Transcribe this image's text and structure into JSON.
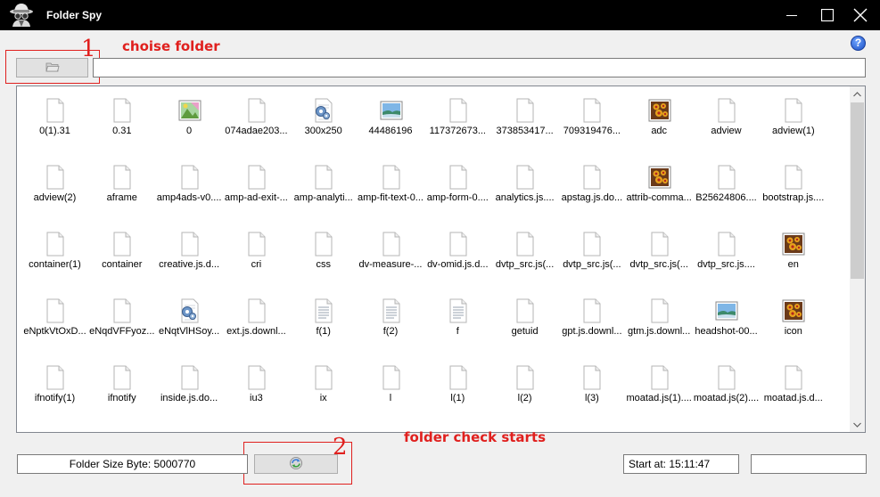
{
  "window": {
    "title": "Folder Spy"
  },
  "annotations": {
    "step1_text": "choise folder",
    "step1_num": "1",
    "step2_text": "folder check starts",
    "step2_num": "2"
  },
  "toolbar": {
    "path_value": "",
    "help_label": "?"
  },
  "files": [
    {
      "name": "0(1).31",
      "icon": "file"
    },
    {
      "name": "0.31",
      "icon": "file"
    },
    {
      "name": "0",
      "icon": "image-green"
    },
    {
      "name": "074adae203...",
      "icon": "file"
    },
    {
      "name": "300x250",
      "icon": "gear"
    },
    {
      "name": "44486196",
      "icon": "image-landscape"
    },
    {
      "name": "117372673...",
      "icon": "file"
    },
    {
      "name": "373853417...",
      "icon": "file"
    },
    {
      "name": "709319476...",
      "icon": "file"
    },
    {
      "name": "adc",
      "icon": "image-flower"
    },
    {
      "name": "adview",
      "icon": "file"
    },
    {
      "name": "adview(1)",
      "icon": "file"
    },
    {
      "name": "adview(2)",
      "icon": "file"
    },
    {
      "name": "aframe",
      "icon": "file"
    },
    {
      "name": "amp4ads-v0....",
      "icon": "file"
    },
    {
      "name": "amp-ad-exit-...",
      "icon": "file"
    },
    {
      "name": "amp-analyti...",
      "icon": "file"
    },
    {
      "name": "amp-fit-text-0...",
      "icon": "file"
    },
    {
      "name": "amp-form-0....",
      "icon": "file"
    },
    {
      "name": "analytics.js....",
      "icon": "file"
    },
    {
      "name": "apstag.js.do...",
      "icon": "file"
    },
    {
      "name": "attrib-comma...",
      "icon": "image-flower"
    },
    {
      "name": "B25624806....",
      "icon": "file"
    },
    {
      "name": "bootstrap.js....",
      "icon": "file"
    },
    {
      "name": "container(1)",
      "icon": "file"
    },
    {
      "name": "container",
      "icon": "file"
    },
    {
      "name": "creative.js.d...",
      "icon": "file"
    },
    {
      "name": "cri",
      "icon": "file"
    },
    {
      "name": "css",
      "icon": "file"
    },
    {
      "name": "dv-measure-...",
      "icon": "file"
    },
    {
      "name": "dv-omid.js.d...",
      "icon": "file"
    },
    {
      "name": "dvtp_src.js(...",
      "icon": "file"
    },
    {
      "name": "dvtp_src.js(...",
      "icon": "file"
    },
    {
      "name": "dvtp_src.js(...",
      "icon": "file"
    },
    {
      "name": "dvtp_src.js....",
      "icon": "file"
    },
    {
      "name": "en",
      "icon": "image-flower"
    },
    {
      "name": "eNptkVtOxD...",
      "icon": "file"
    },
    {
      "name": "eNqdVFFyoz...",
      "icon": "file"
    },
    {
      "name": "eNqtVlHSoy...",
      "icon": "gear"
    },
    {
      "name": "ext.js.downl...",
      "icon": "file"
    },
    {
      "name": "f(1)",
      "icon": "text"
    },
    {
      "name": "f(2)",
      "icon": "text"
    },
    {
      "name": "f",
      "icon": "text"
    },
    {
      "name": "getuid",
      "icon": "file"
    },
    {
      "name": "gpt.js.downl...",
      "icon": "file"
    },
    {
      "name": "gtm.js.downl...",
      "icon": "file"
    },
    {
      "name": "headshot-00...",
      "icon": "image-landscape"
    },
    {
      "name": "icon",
      "icon": "image-flower"
    },
    {
      "name": "ifnotify(1)",
      "icon": "file"
    },
    {
      "name": "ifnotify",
      "icon": "file"
    },
    {
      "name": "inside.js.do...",
      "icon": "file"
    },
    {
      "name": "iu3",
      "icon": "file"
    },
    {
      "name": "ix",
      "icon": "file"
    },
    {
      "name": "l",
      "icon": "file"
    },
    {
      "name": "l(1)",
      "icon": "file"
    },
    {
      "name": "l(2)",
      "icon": "file"
    },
    {
      "name": "l(3)",
      "icon": "file"
    },
    {
      "name": "moatad.js(1)....",
      "icon": "file"
    },
    {
      "name": "moatad.js(2)....",
      "icon": "file"
    },
    {
      "name": "moatad.js.d...",
      "icon": "file"
    }
  ],
  "status": {
    "folder_size_label": "Folder Size Byte:  5000770",
    "start_label": "Start at:  15:11:47",
    "end_value": ""
  }
}
